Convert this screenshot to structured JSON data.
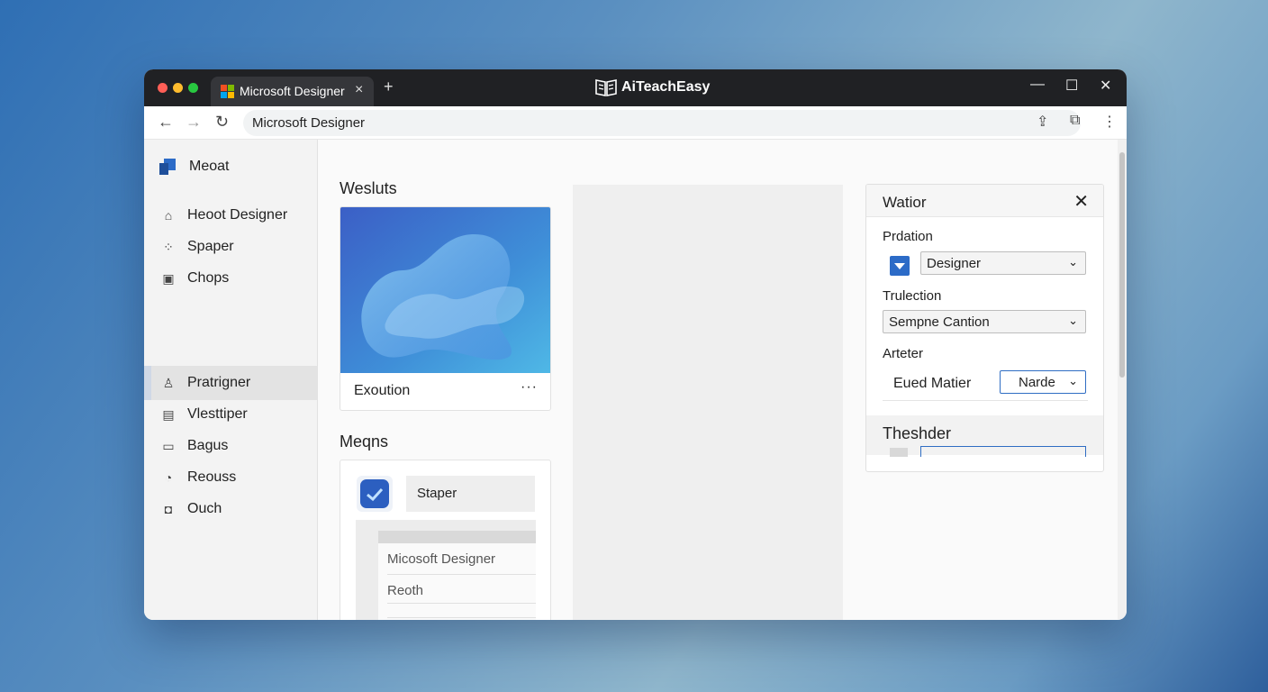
{
  "browser": {
    "tab_title": "Microsoft Designer",
    "tab_close": "×",
    "new_tab": "+",
    "brand": "AiTeachEasy",
    "url": "Microsoft Designer",
    "window_controls": {
      "minimize": "—",
      "maximize": "☐",
      "close": "✕"
    },
    "nav": {
      "back": "←",
      "forward": "→",
      "reload": "↻"
    },
    "toolbar": {
      "share": "⇪",
      "extensions": "⧉",
      "menu": "⋮"
    }
  },
  "sidebar": {
    "header": "Meoat",
    "items": [
      {
        "label": "Heoot Designer",
        "icon": "home-icon",
        "glyph": "⌂"
      },
      {
        "label": "Spaper",
        "icon": "grid-icon",
        "glyph": "⁘"
      },
      {
        "label": "Chops",
        "icon": "layout-icon",
        "glyph": "▣"
      },
      {
        "label": "Pratrigner",
        "icon": "person-icon",
        "glyph": "♙"
      },
      {
        "label": "Vlesttiper",
        "icon": "calendar-icon",
        "glyph": "▤"
      },
      {
        "label": "Bagus",
        "icon": "image-icon",
        "glyph": "▭"
      },
      {
        "label": "Reouss",
        "icon": "history-icon",
        "glyph": "◔"
      },
      {
        "label": "Ouch",
        "icon": "box-icon",
        "glyph": "◘"
      }
    ]
  },
  "main": {
    "results_title": "Wesluts",
    "card": {
      "label": "Exoution",
      "more": "···"
    },
    "menus_title": "Meqns",
    "menu_card": {
      "field_label": "Staper",
      "rows": [
        "Micosoft Designer",
        "Reoth"
      ]
    }
  },
  "panel": {
    "title": "Watior",
    "close": "✕",
    "section1_label": "Prdation",
    "select1": "Designer",
    "section2_label": "Trulection",
    "select2": "Sempne Cantion",
    "section3_label": "Arteter",
    "row_label": "Eued Matier",
    "select3": "Narde",
    "chevron": "⌄",
    "footer_title": "Theshder"
  },
  "colors": {
    "accent": "#2c6bc7",
    "titlebar": "#202124",
    "sidebar_bg": "#f3f3f3"
  }
}
